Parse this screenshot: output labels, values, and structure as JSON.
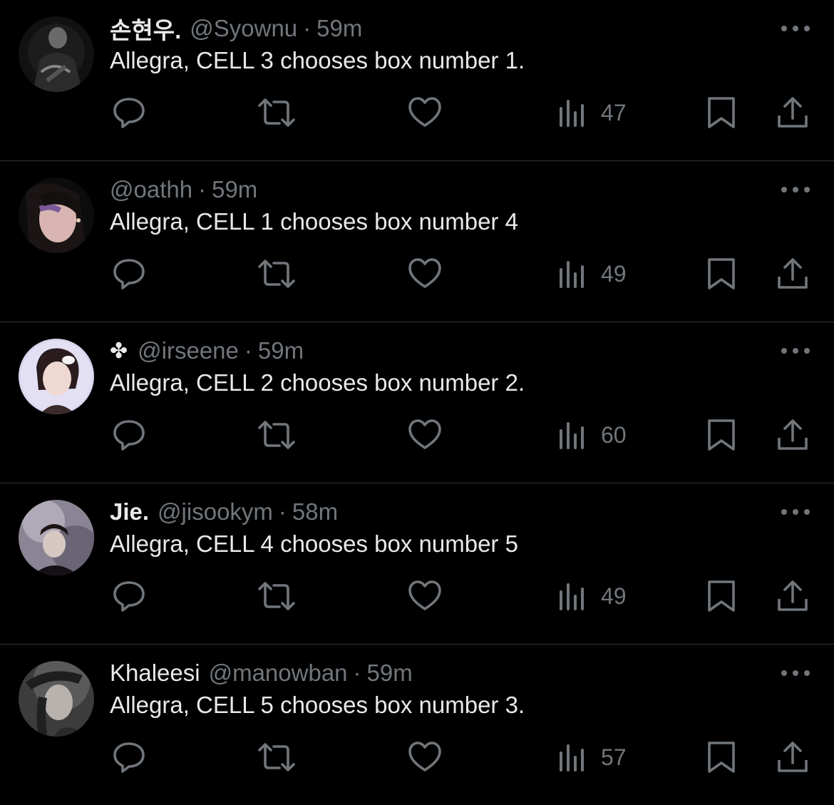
{
  "colors": {
    "background": "#000000",
    "text_primary": "#e7e9ea",
    "text_secondary": "#71767b",
    "divider": "#2f3336"
  },
  "icons": {
    "reply": "reply-icon",
    "retweet": "retweet-icon",
    "like": "heart-icon",
    "views": "analytics-icon",
    "bookmark": "bookmark-icon",
    "share": "share-icon",
    "more": "more-options-icon"
  },
  "tweets": [
    {
      "display_name": "손현우.",
      "display_bold": true,
      "handle": "@Syownu",
      "separator": "·",
      "time": "59m",
      "text": "Allegra, CELL 3 chooses box number 1.",
      "views": "47"
    },
    {
      "display_name": "",
      "display_bold": false,
      "handle": "@oathh",
      "separator": "·",
      "time": "59m",
      "text": "Allegra, CELL 1 chooses box number 4",
      "views": "49"
    },
    {
      "display_name": "",
      "display_icon": "✤",
      "display_bold": false,
      "handle": "@irseene",
      "separator": "·",
      "time": "59m",
      "text": "Allegra, CELL 2 chooses box number 2.",
      "views": "60"
    },
    {
      "display_name": "Jie.",
      "display_bold": true,
      "handle": "@jisookym",
      "separator": "·",
      "time": "58m",
      "text": "Allegra, CELL 4 chooses box number 5",
      "views": "49"
    },
    {
      "display_name": "Khaleesi",
      "display_bold": false,
      "handle": "@manowban",
      "separator": "·",
      "time": "59m",
      "text": "Allegra, CELL 5 chooses box number 3.",
      "views": "57"
    }
  ]
}
